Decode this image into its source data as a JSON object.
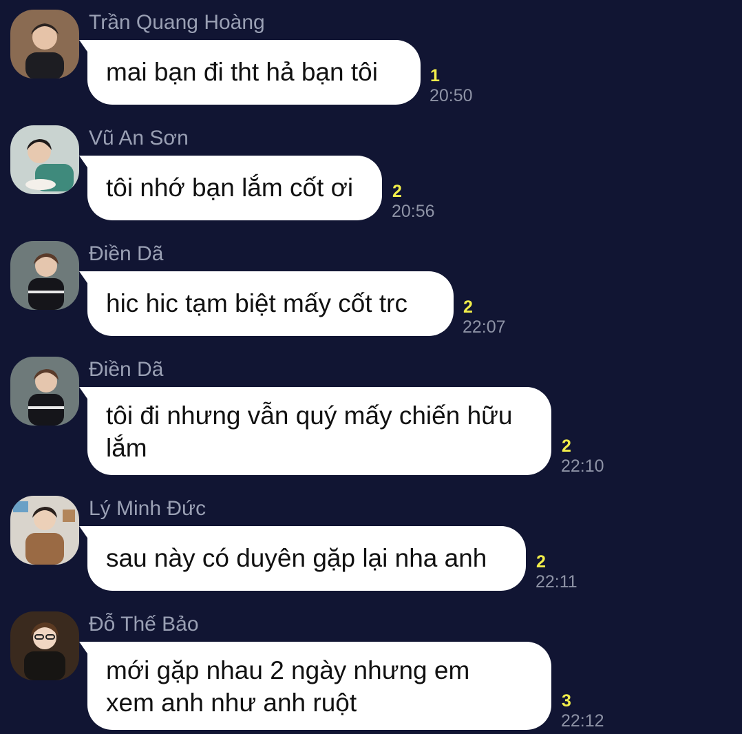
{
  "colors": {
    "background": "#111533",
    "bubble": "#ffffff",
    "sender_name": "#9aa0b4",
    "unread_count": "#f2ee4a",
    "timestamp": "#8e93a6"
  },
  "messages": [
    {
      "sender": "Trần Quang Hoàng",
      "text": "mai bạn đi tht hả bạn tôi",
      "unread": "1",
      "time": "20:50",
      "avatar_icon": "user-avatar-icon"
    },
    {
      "sender": "Vũ An Sơn",
      "text": "tôi nhớ bạn lắm cốt ơi",
      "unread": "2",
      "time": "20:56",
      "avatar_icon": "user-avatar-icon"
    },
    {
      "sender": "Điền Dã",
      "text": "hic hic tạm biệt mấy cốt trc",
      "unread": "2",
      "time": "22:07",
      "avatar_icon": "user-avatar-icon"
    },
    {
      "sender": "Điền Dã",
      "text": "tôi đi nhưng vẫn quý mấy chiến hữu\nlắm",
      "unread": "2",
      "time": "22:10",
      "avatar_icon": "user-avatar-icon"
    },
    {
      "sender": "Lý Minh Đức",
      "text": "sau này có duyên gặp lại nha anh",
      "unread": "2",
      "time": "22:11",
      "avatar_icon": "user-avatar-icon"
    },
    {
      "sender": "Đỗ Thế Bảo",
      "text": "mới gặp nhau 2 ngày nhưng em\nxem anh như anh ruột",
      "unread": "3",
      "time": "22:12",
      "avatar_icon": "user-avatar-icon"
    }
  ]
}
